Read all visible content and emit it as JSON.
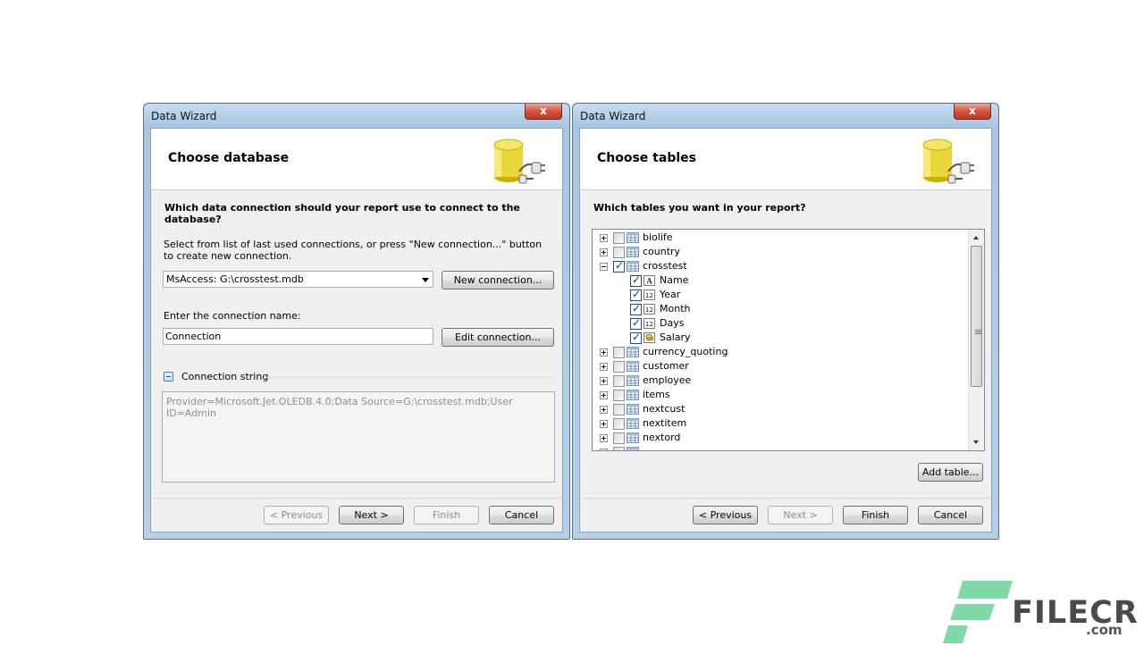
{
  "left_dialog": {
    "title": "Data Wizard",
    "close_label": "x",
    "header_title": "Choose database",
    "question": "Which data connection should your report use to connect to the database?",
    "instructions": "Select from list of last used connections, or press \"New connection...\" button to create new connection.",
    "connection_select": "MsAccess: G:\\crosstest.mdb",
    "new_connection_label": "New connection...",
    "connection_name_label": "Enter the connection name:",
    "connection_name_value": "Connection",
    "edit_connection_label": "Edit connection...",
    "connection_string_label": "Connection string",
    "connection_string_value": "Provider=Microsoft.Jet.OLEDB.4.0;Data Source=G:\\crosstest.mdb;User ID=Admin",
    "buttons": {
      "previous": "< Previous",
      "next": "Next >",
      "finish": "Finish",
      "cancel": "Cancel"
    }
  },
  "right_dialog": {
    "title": "Data Wizard",
    "close_label": "x",
    "header_title": "Choose tables",
    "question": "Which tables you want in your report?",
    "tree": [
      {
        "name": "biolife",
        "level": 0,
        "expander": "plus",
        "checked": false,
        "icon": "table-icon"
      },
      {
        "name": "country",
        "level": 0,
        "expander": "plus",
        "checked": false,
        "icon": "table-icon"
      },
      {
        "name": "crosstest",
        "level": 0,
        "expander": "minus",
        "checked": true,
        "icon": "table-icon"
      },
      {
        "name": "Name",
        "level": 1,
        "expander": "",
        "checked": true,
        "icon": "text-field-icon"
      },
      {
        "name": "Year",
        "level": 1,
        "expander": "",
        "checked": true,
        "icon": "number-field-icon"
      },
      {
        "name": "Month",
        "level": 1,
        "expander": "",
        "checked": true,
        "icon": "number-field-icon"
      },
      {
        "name": "Days",
        "level": 1,
        "expander": "",
        "checked": true,
        "icon": "number-field-icon"
      },
      {
        "name": "Salary",
        "level": 1,
        "expander": "",
        "checked": true,
        "icon": "currency-field-icon"
      },
      {
        "name": "currency_quoting",
        "level": 0,
        "expander": "plus",
        "checked": false,
        "icon": "table-icon"
      },
      {
        "name": "customer",
        "level": 0,
        "expander": "plus",
        "checked": false,
        "icon": "table-icon"
      },
      {
        "name": "employee",
        "level": 0,
        "expander": "plus",
        "checked": false,
        "icon": "table-icon"
      },
      {
        "name": "items",
        "level": 0,
        "expander": "plus",
        "checked": false,
        "icon": "table-icon"
      },
      {
        "name": "nextcust",
        "level": 0,
        "expander": "plus",
        "checked": false,
        "icon": "table-icon"
      },
      {
        "name": "nextitem",
        "level": 0,
        "expander": "plus",
        "checked": false,
        "icon": "table-icon"
      },
      {
        "name": "nextord",
        "level": 0,
        "expander": "plus",
        "checked": false,
        "icon": "table-icon"
      },
      {
        "name": "",
        "level": 0,
        "expander": "plus",
        "checked": false,
        "icon": "table-icon"
      }
    ],
    "add_table_label": "Add table...",
    "buttons": {
      "previous": "< Previous",
      "next": "Next >",
      "finish": "Finish",
      "cancel": "Cancel"
    }
  },
  "watermark": {
    "brand": "FILECR",
    "suffix": ".com"
  },
  "colors": {
    "accent_green": "#7fd9a8",
    "title_bar": "#b7d0e8"
  }
}
